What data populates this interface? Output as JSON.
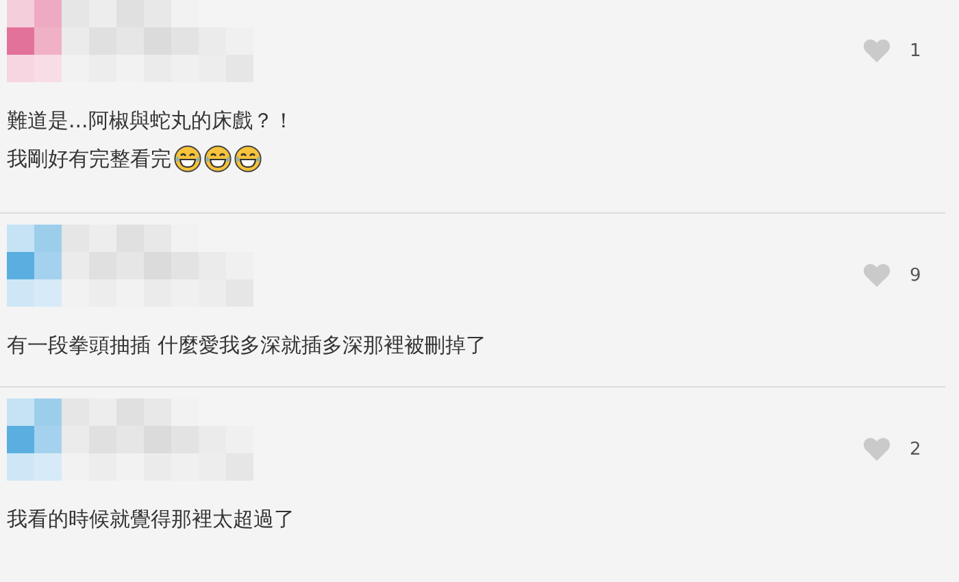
{
  "comments": [
    {
      "color": "#e3729a",
      "likes": "1",
      "lines": [
        "難道是...阿椒與蛇丸的床戲？！",
        "我剛好有完整看完"
      ],
      "emojis": [
        {
          "kind": "laughing"
        },
        {
          "kind": "laughing"
        },
        {
          "kind": "laughing"
        }
      ]
    },
    {
      "color": "#5aaee0",
      "likes": "9",
      "lines": [
        "有一段拳頭抽插 什麼愛我多深就插多深那裡被刪掉了"
      ]
    },
    {
      "color": "#5aaee0",
      "likes": "2",
      "lines": [
        "我看的時候就覺得那裡太超過了"
      ]
    }
  ]
}
